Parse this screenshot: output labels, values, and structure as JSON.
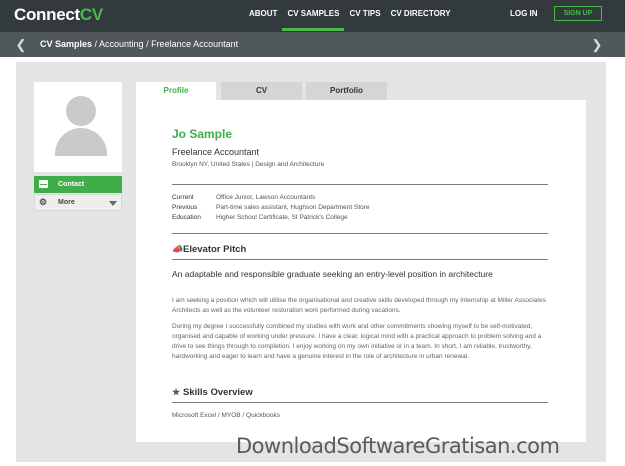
{
  "nav": {
    "logo_text": "Connect",
    "logo_mark": "CV",
    "links": [
      "ABOUT",
      "CV SAMPLES",
      "CV TIPS",
      "CV DIRECTORY"
    ],
    "active_link": "CV SAMPLES",
    "login": "LOG IN",
    "signup": "SIGN UP",
    "accent_color": "#4ab84a"
  },
  "breadcrumb": {
    "first": "CV Samples",
    "rest": " / Accounting / Freelance Accountant",
    "prev_icon": "chevron-left-icon",
    "next_icon": "chevron-right-icon"
  },
  "sidebar": {
    "avatar_icon": "user-placeholder-icon",
    "contact_label": "Contact",
    "contact_icon": "envelope-icon",
    "more_label": "More",
    "more_icon": "gear-icon"
  },
  "tabs": [
    {
      "label": "Profile",
      "active": true
    },
    {
      "label": "CV",
      "active": false
    },
    {
      "label": "Portfolio",
      "active": false
    }
  ],
  "profile": {
    "name": "Jo Sample",
    "title": "Freelance Accountant",
    "location": "Brooklyn NY, United States | Design and Architecture",
    "details": [
      {
        "key": "Current",
        "value": "Office Junior, Lawson Accountants"
      },
      {
        "key": "Previous",
        "value": "Part-time sales assistant, Hughson Department Store"
      },
      {
        "key": "Education",
        "value": "Higher School Certificate, St Patrick's College"
      }
    ]
  },
  "elevator_pitch": {
    "title": "Elevator Pitch",
    "icon": "megaphone-icon",
    "headline": "An adaptable and responsible graduate seeking an entry-level position in architecture",
    "para1": "I am seeking a position which will utilise the organisational and creative skills developed through my internship at Miller Associates Architects as well as the volunteer restoration work performed during vacations.",
    "para2": "During my degree I successfully combined my studies with work and other commitments showing myself to be self-motivated, organised and capable of working under pressure. I have a clear, logical mind with a practical approach to problem solving and a drive to see things through to completion. I enjoy working on my own initiative or in a team. In short, I am reliable, trustworthy, hardworking and eager to learn and have a genuine interest in the role of architecture in urban renewal."
  },
  "skills": {
    "title": "Skills Overview",
    "icon": "star-icon",
    "list": "Microsoft Excel / MYOB / Quickbooks"
  },
  "watermark": "DownloadSoftwareGratisan.com"
}
